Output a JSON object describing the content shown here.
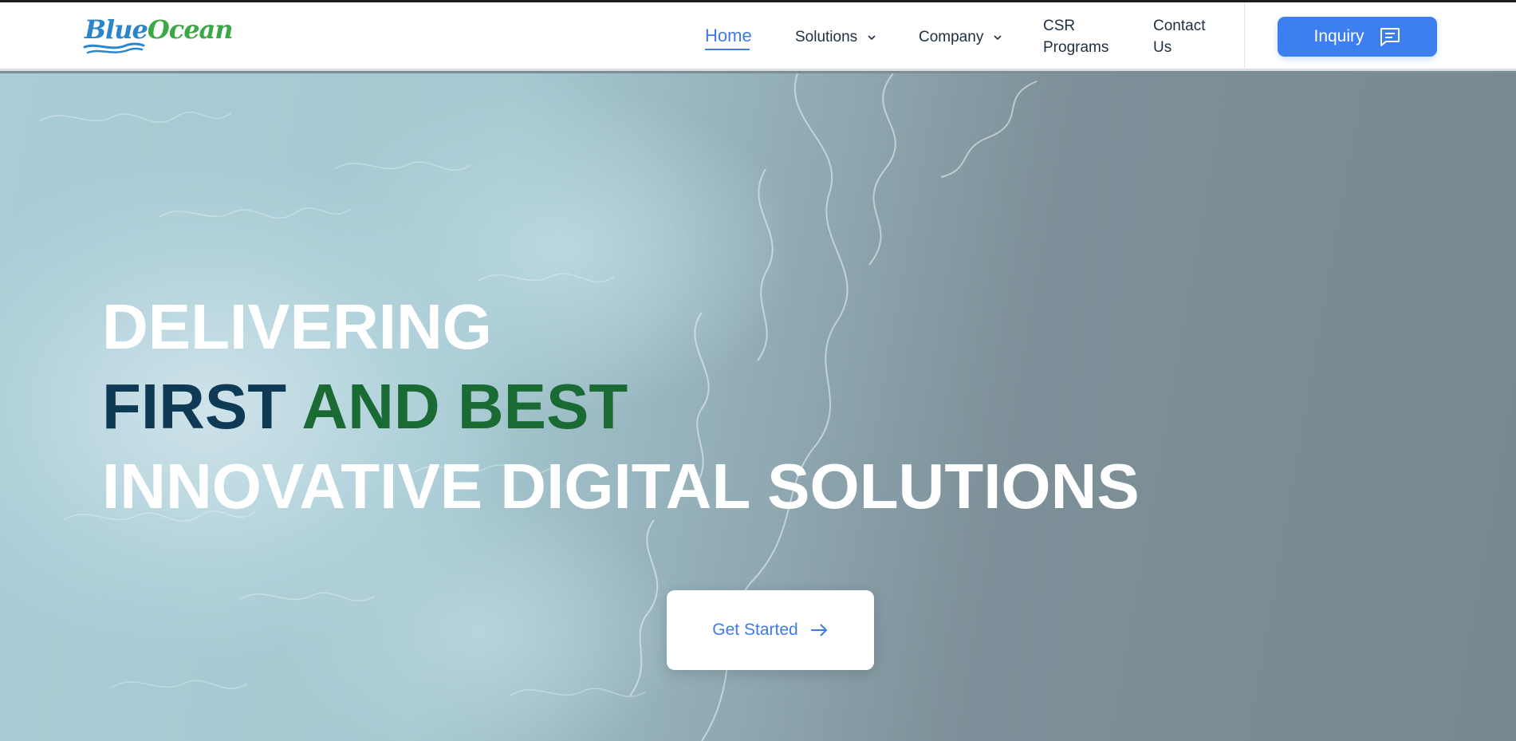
{
  "brand": {
    "logo_part1": "Blue",
    "logo_part2": "Ocean",
    "colors": {
      "blue": "#2a86c9",
      "green": "#3ba846"
    }
  },
  "nav": {
    "home": "Home",
    "solutions": "Solutions",
    "company": "Company",
    "csr_line1": "CSR",
    "csr_line2": "Programs",
    "contact_line1": "Contact",
    "contact_line2": "Us",
    "active": "Home"
  },
  "header": {
    "inquiry_label": "Inquiry",
    "inquiry_icon": "chat-message-icon",
    "accent_color": "#3d7ff0"
  },
  "hero": {
    "line1": "DELIVERING",
    "line2_part1": "FIRST",
    "line2_part2": "AND BEST",
    "line3": "INNOVATIVE DIGITAL SOLUTIONS",
    "cta_label": "Get Started",
    "cta_icon": "arrow-right-icon",
    "colors": {
      "navy": "#0f3a55",
      "green": "#196b33",
      "white": "#ffffff"
    }
  }
}
